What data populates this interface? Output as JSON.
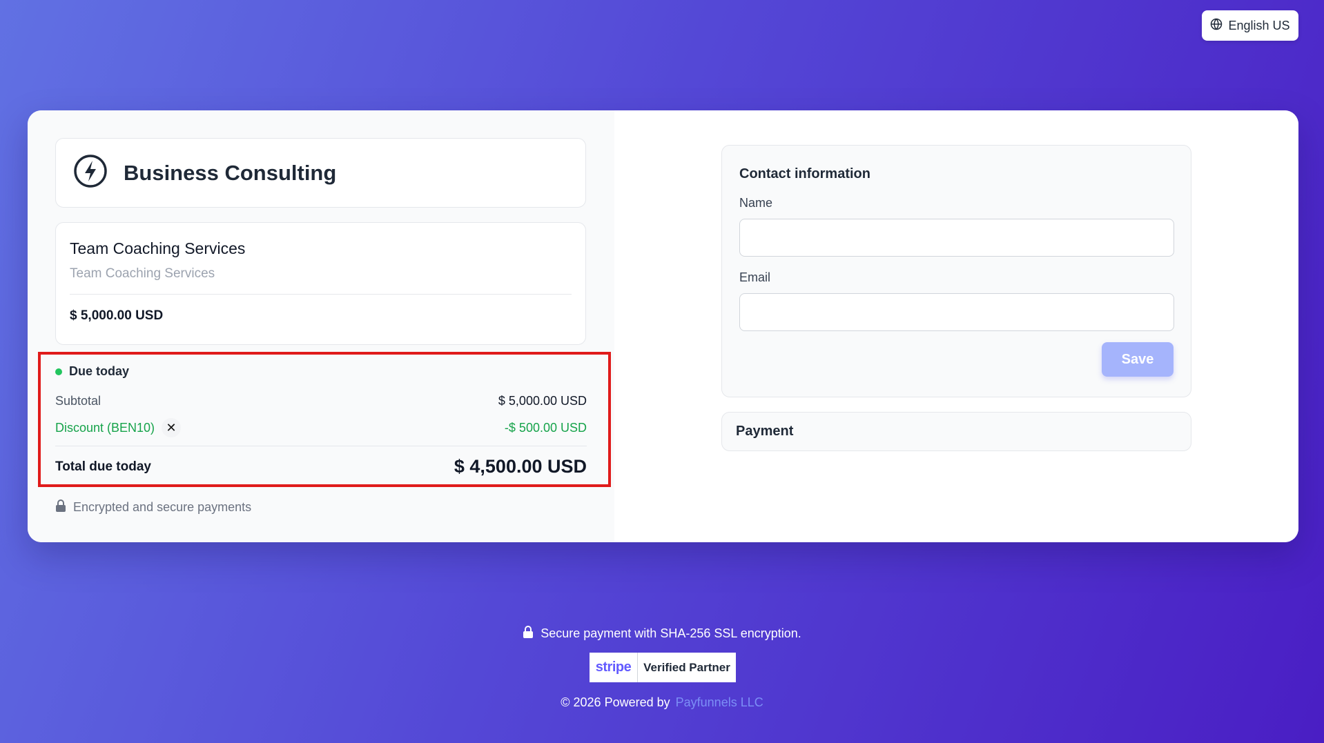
{
  "language": {
    "label": "English US",
    "icon": "globe-icon"
  },
  "business": {
    "name": "Business Consulting",
    "icon": "lightning-icon"
  },
  "product": {
    "name": "Team Coaching Services",
    "description": "Team Coaching Services",
    "price": "$ 5,000.00 USD"
  },
  "summary": {
    "due_label": "Due today",
    "subtotal_label": "Subtotal",
    "subtotal_value": "$ 5,000.00 USD",
    "discount_label": "Discount (BEN10)",
    "discount_remove": "✕",
    "discount_value": "-$ 500.00 USD",
    "total_label": "Total due today",
    "total_value": "$ 4,500.00 USD",
    "colors": {
      "discount": "#16a34a",
      "due_dot": "#22c55e",
      "highlight_border": "#e01b1b"
    }
  },
  "secure_note": "Encrypted and secure payments",
  "contact": {
    "title": "Contact information",
    "name_label": "Name",
    "name_value": "",
    "email_label": "Email",
    "email_value": "",
    "save_label": "Save"
  },
  "payment": {
    "title": "Payment"
  },
  "footer": {
    "secure_text": "Secure payment with SHA-256 SSL encryption.",
    "stripe_brand": "stripe",
    "verified_text": "Verified Partner",
    "copyright_text": "© 2026 Powered by",
    "company_link": "Payfunnels LLC"
  }
}
